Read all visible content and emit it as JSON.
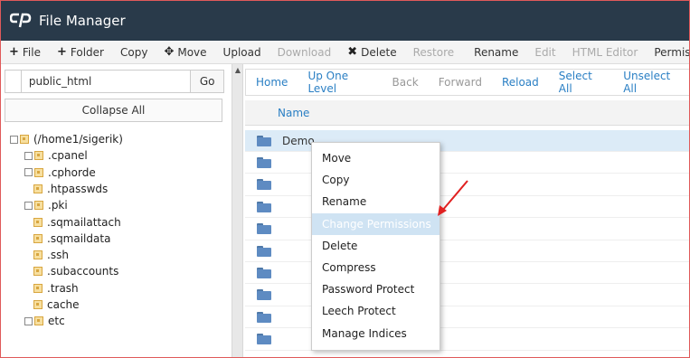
{
  "header": {
    "title": "File Manager"
  },
  "toolbar": {
    "items": [
      {
        "label": "File",
        "icon": "+",
        "disabled": false
      },
      {
        "label": "Folder",
        "icon": "+",
        "disabled": false
      },
      {
        "label": "Copy",
        "icon": "",
        "disabled": false
      },
      {
        "label": "Move",
        "icon": "✥",
        "disabled": false
      },
      {
        "label": "Upload",
        "icon": "",
        "disabled": false
      },
      {
        "label": "Download",
        "icon": "",
        "disabled": true
      },
      {
        "label": "Delete",
        "icon": "✖",
        "disabled": false
      },
      {
        "label": "Restore",
        "icon": "",
        "disabled": true
      },
      {
        "label": "Rename",
        "icon": "",
        "disabled": false
      },
      {
        "label": "Edit",
        "icon": "",
        "disabled": true
      },
      {
        "label": "HTML Editor",
        "icon": "",
        "disabled": true
      },
      {
        "label": "Permiss",
        "icon": "",
        "disabled": false
      }
    ]
  },
  "left": {
    "path_value": "public_html",
    "go_label": "Go",
    "collapse_label": "Collapse All",
    "tree": [
      {
        "label": "(/home1/sigerik)",
        "expandable": true
      },
      {
        "label": ".cpanel",
        "expandable": true
      },
      {
        "label": ".cphorde",
        "expandable": true
      },
      {
        "label": ".htpasswds",
        "expandable": false
      },
      {
        "label": ".pki",
        "expandable": true
      },
      {
        "label": ".sqmailattach",
        "expandable": false
      },
      {
        "label": ".sqmaildata",
        "expandable": false
      },
      {
        "label": ".ssh",
        "expandable": false
      },
      {
        "label": ".subaccounts",
        "expandable": false
      },
      {
        "label": ".trash",
        "expandable": false
      },
      {
        "label": "cache",
        "expandable": false
      },
      {
        "label": "etc",
        "expandable": true
      }
    ]
  },
  "right": {
    "nav": [
      {
        "label": "Home",
        "disabled": false
      },
      {
        "label": "Up One Level",
        "disabled": false
      },
      {
        "label": "Back",
        "disabled": true
      },
      {
        "label": "Forward",
        "disabled": true
      },
      {
        "label": "Reload",
        "disabled": false
      },
      {
        "label": "Select All",
        "disabled": false
      },
      {
        "label": "Unselect All",
        "disabled": false
      }
    ],
    "column_name": "Name",
    "rows": [
      {
        "name": "Demo",
        "selected": true
      },
      {
        "name": "",
        "selected": false
      },
      {
        "name": "",
        "selected": false
      },
      {
        "name": "",
        "selected": false
      },
      {
        "name": "",
        "selected": false
      },
      {
        "name": "",
        "selected": false
      },
      {
        "name": "",
        "selected": false
      },
      {
        "name": "",
        "selected": false
      },
      {
        "name": "",
        "selected": false
      },
      {
        "name": "",
        "selected": false
      }
    ]
  },
  "context_menu": {
    "items": [
      {
        "label": "Move",
        "highlight": false
      },
      {
        "label": "Copy",
        "highlight": false
      },
      {
        "label": "Rename",
        "highlight": false
      },
      {
        "label": "Change Permissions",
        "highlight": true
      },
      {
        "label": "Delete",
        "highlight": false
      },
      {
        "label": "Compress",
        "highlight": false
      },
      {
        "label": "Password Protect",
        "highlight": false
      },
      {
        "label": "Leech Protect",
        "highlight": false
      },
      {
        "label": "Manage Indices",
        "highlight": false
      }
    ]
  },
  "colors": {
    "header_bg": "#293a4a",
    "link_blue": "#2a7fc4",
    "annotation_red": "#e02020",
    "selection": "#dcebf7"
  }
}
